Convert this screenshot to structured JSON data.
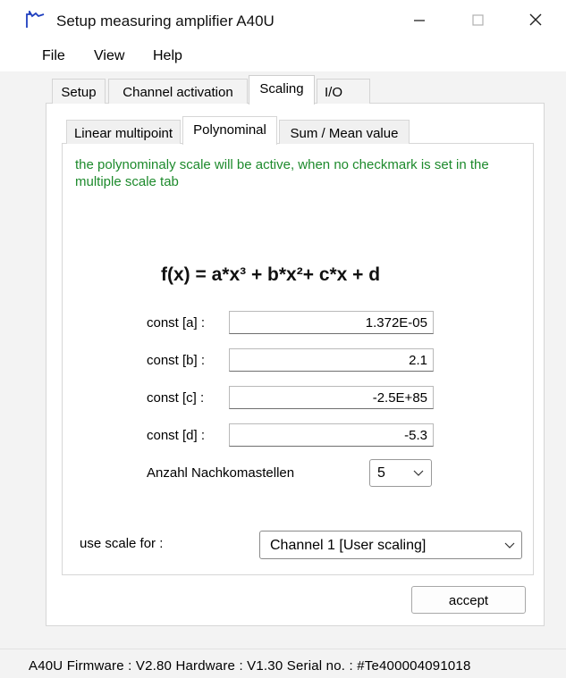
{
  "window": {
    "title": "Setup measuring amplifier A40U"
  },
  "menu": {
    "file": "File",
    "view": "View",
    "help": "Help"
  },
  "outer_tabs": [
    {
      "label": "Setup"
    },
    {
      "label": "Channel activation"
    },
    {
      "label": "Scaling",
      "active": true
    },
    {
      "label": "I/O"
    }
  ],
  "inner_tabs": [
    {
      "label": "Linear multipoint"
    },
    {
      "label": "Polynominal",
      "active": true
    },
    {
      "label": "Sum / Mean value"
    }
  ],
  "polynomial": {
    "info": "the polynominaly scale will be active, when no checkmark is set in the multiple scale tab",
    "formula": "f(x) = a*x³ + b*x²+ c*x + d",
    "consts": [
      {
        "label": "const [a] :",
        "value": "1.372E-05"
      },
      {
        "label": "const [b] :",
        "value": "2.1"
      },
      {
        "label": "const [c] :",
        "value": "-2.5E+85"
      },
      {
        "label": "const [d] :",
        "value": "-5.3"
      }
    ],
    "decimals_label": "Anzahl Nachkomastellen",
    "decimals_value": "5"
  },
  "scale": {
    "label": "use scale for :",
    "value": "Channel 1 [User scaling]"
  },
  "accept_label": "accept",
  "status": "A40U  Firmware : V2.80  Hardware : V1.30  Serial no. : #Te400004091018",
  "colors": {
    "info_text": "#1d8a2c",
    "app_icon": "#1f3fbf"
  }
}
